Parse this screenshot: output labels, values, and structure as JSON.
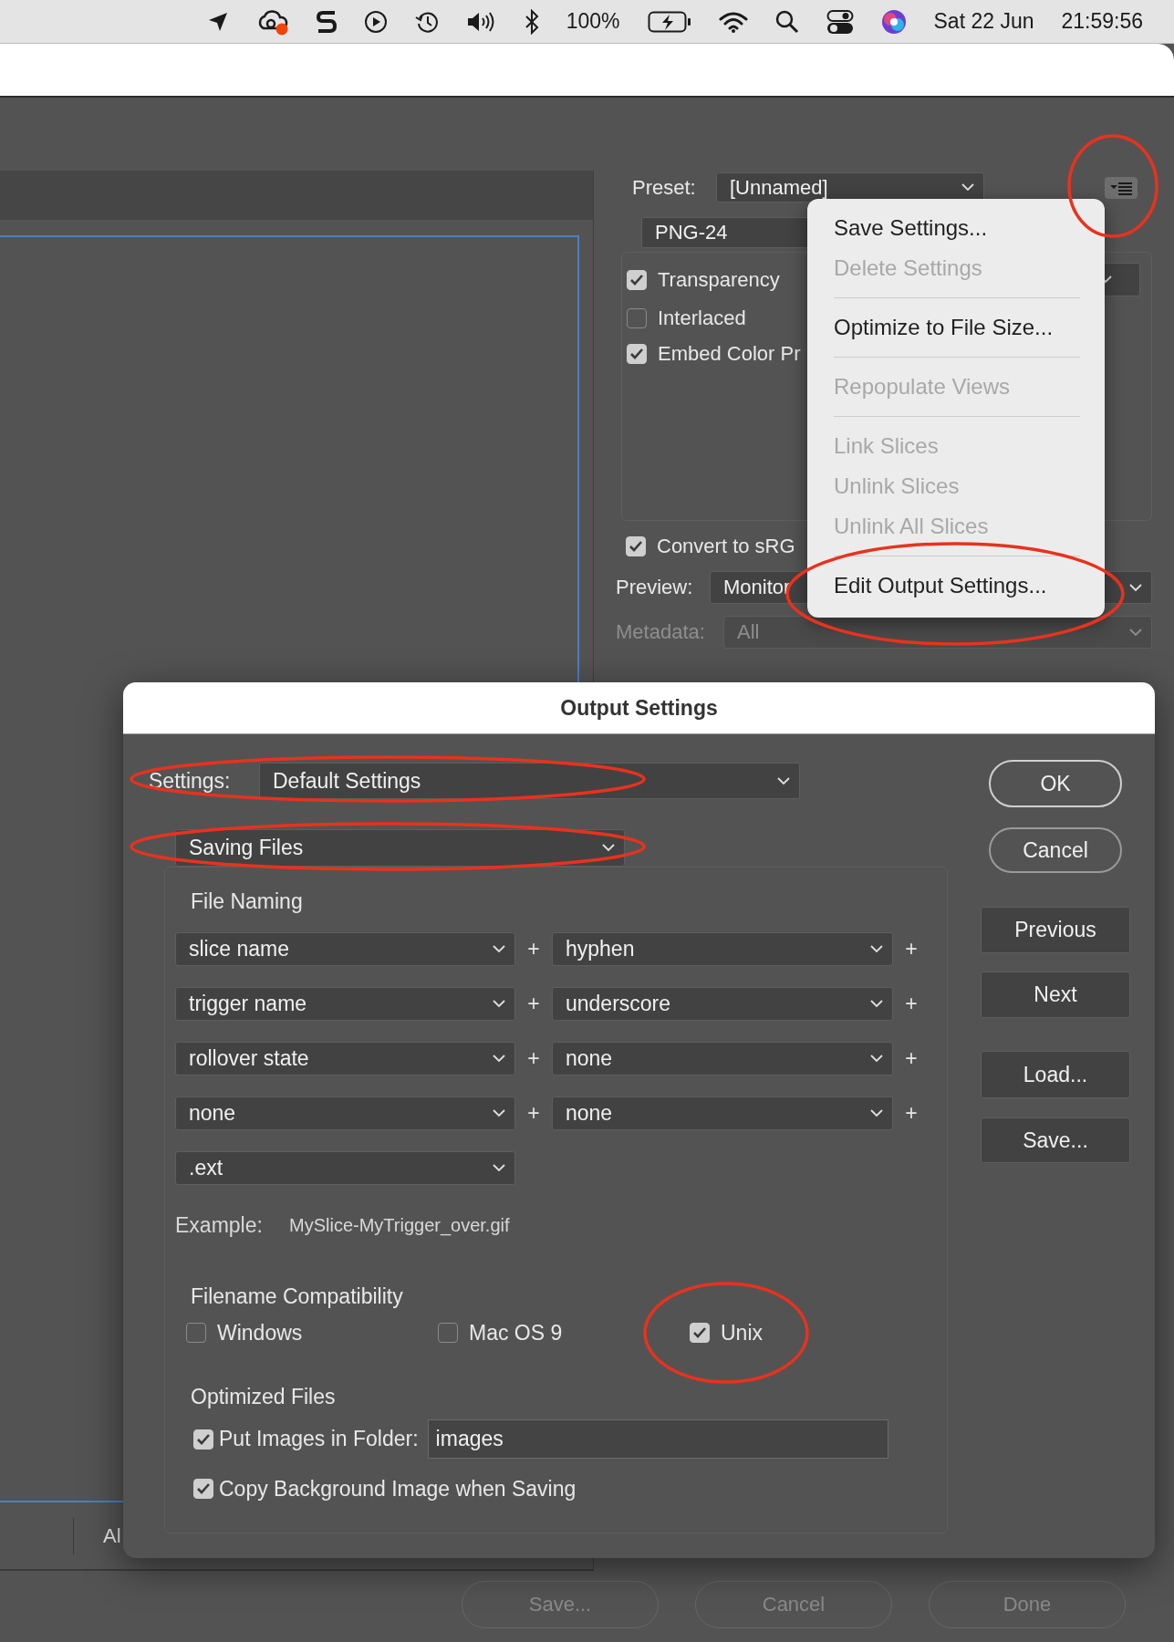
{
  "menu_bar": {
    "battery_percent": "100%",
    "date": "Sat 22 Jun",
    "time": "21:59:56"
  },
  "optimize_panel": {
    "preset_label": "Preset:",
    "preset": "[Unnamed]",
    "format": "PNG-24",
    "options": [
      {
        "label": "Transparency",
        "checked": true
      },
      {
        "label": "Interlaced",
        "checked": false
      },
      {
        "label": "Embed Color Pr",
        "checked": true
      }
    ],
    "convert": {
      "label": "Convert to sRG",
      "checked": true
    },
    "preview_label": "Preview:",
    "preview": "Monitor",
    "metadata_label": "Metadata:",
    "metadata": "All"
  },
  "flyout_menu": [
    {
      "kind": "item",
      "label": "Save Settings...",
      "disabled": false
    },
    {
      "kind": "item",
      "label": "Delete Settings",
      "disabled": true
    },
    {
      "kind": "separator"
    },
    {
      "kind": "item",
      "label": "Optimize to File Size...",
      "disabled": false
    },
    {
      "kind": "separator"
    },
    {
      "kind": "item",
      "label": "Repopulate Views",
      "disabled": true
    },
    {
      "kind": "separator"
    },
    {
      "kind": "item",
      "label": "Link Slices",
      "disabled": true
    },
    {
      "kind": "item",
      "label": "Unlink Slices",
      "disabled": true
    },
    {
      "kind": "item",
      "label": "Unlink All Slices",
      "disabled": true
    },
    {
      "kind": "separator"
    },
    {
      "kind": "item",
      "label": "Edit Output Settings...",
      "disabled": false
    }
  ],
  "canvas_status": "Al",
  "footer_buttons": [
    {
      "label": "Save..."
    },
    {
      "label": "Cancel"
    },
    {
      "label": "Done"
    }
  ],
  "dialog": {
    "title": "Output Settings",
    "settings_label": "Settings:",
    "settings": "Default Settings",
    "section": "Saving Files",
    "file_naming": {
      "title": "File Naming",
      "rows": [
        {
          "fields": [
            "slice name",
            "hyphen"
          ],
          "joiners": [
            "+",
            "+"
          ]
        },
        {
          "fields": [
            "trigger name",
            "underscore"
          ],
          "joiners": [
            "+",
            "+"
          ]
        },
        {
          "fields": [
            "rollover state",
            "none"
          ],
          "joiners": [
            "+",
            "+"
          ]
        },
        {
          "fields": [
            "none",
            "none"
          ],
          "joiners": [
            "+",
            "+"
          ]
        },
        {
          "fields": [
            ".ext"
          ],
          "joiners": []
        }
      ],
      "example_label": "Example:",
      "example": "MySlice-MyTrigger_over.gif"
    },
    "compatibility": {
      "title": "Filename Compatibility",
      "options": [
        {
          "label": "Windows",
          "checked": false
        },
        {
          "label": "Mac OS 9",
          "checked": false
        },
        {
          "label": "Unix",
          "checked": true
        }
      ]
    },
    "optimized_files": {
      "title": "Optimized Files",
      "put_images": {
        "label": "Put Images in Folder:",
        "checked": true,
        "value": "images"
      },
      "copy_background": {
        "label": "Copy Background Image when Saving",
        "checked": true
      }
    },
    "buttons": [
      {
        "label": "OK",
        "kind": "pill"
      },
      {
        "label": "Cancel",
        "kind": "pill"
      },
      {
        "label": "Previous",
        "kind": "square"
      },
      {
        "label": "Next",
        "kind": "square"
      },
      {
        "label": "Load...",
        "kind": "square"
      },
      {
        "label": "Save...",
        "kind": "square"
      }
    ]
  }
}
